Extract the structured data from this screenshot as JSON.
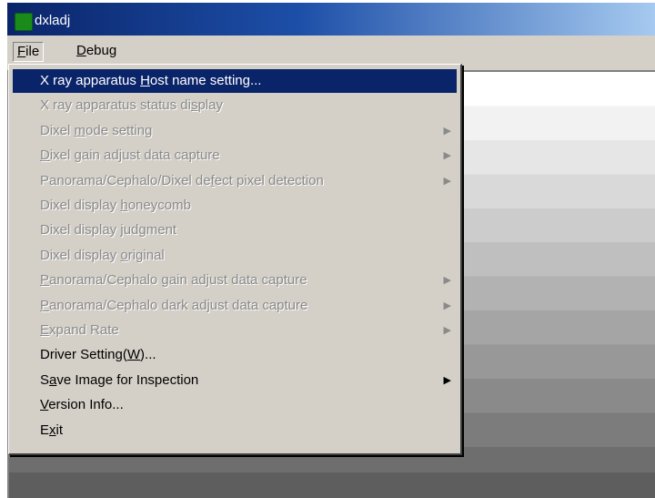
{
  "window": {
    "title": "dxladj",
    "colors": {
      "titlebar_start": "#0a246a",
      "titlebar_end": "#a6caf0",
      "selection": "#0a246a",
      "face": "#d4d0c8"
    }
  },
  "menubar": {
    "items": [
      {
        "label": "File",
        "accel": "F",
        "rest": "ile"
      },
      {
        "label": "Debug",
        "accel": "D",
        "rest": "ebug"
      }
    ]
  },
  "file_menu": {
    "items": [
      {
        "pre": "X ray apparatus ",
        "accel": "H",
        "post": "ost name setting...",
        "enabled": true,
        "selected": true,
        "submenu": false
      },
      {
        "pre": "X ray apparatus status di",
        "accel": "s",
        "post": "play",
        "enabled": false,
        "selected": false,
        "submenu": false
      },
      {
        "pre": "Dixel ",
        "accel": "m",
        "post": "ode setting",
        "enabled": false,
        "selected": false,
        "submenu": true
      },
      {
        "pre": "",
        "accel": "D",
        "post": "ixel gain adjust data capture",
        "enabled": false,
        "selected": false,
        "submenu": true
      },
      {
        "pre": "Panorama/Cephalo/Dixel de",
        "accel": "f",
        "post": "ect pixel detection",
        "enabled": false,
        "selected": false,
        "submenu": true
      },
      {
        "pre": "Dixel display ",
        "accel": "h",
        "post": "oneycomb",
        "enabled": false,
        "selected": false,
        "submenu": false
      },
      {
        "pre": "Dixel display ",
        "accel": "j",
        "post": "udgment",
        "enabled": false,
        "selected": false,
        "submenu": false
      },
      {
        "pre": "Dixel display ",
        "accel": "o",
        "post": "riginal",
        "enabled": false,
        "selected": false,
        "submenu": false
      },
      {
        "pre": "",
        "accel": "P",
        "post": "anorama/Cephalo gain adjust data capture",
        "enabled": false,
        "selected": false,
        "submenu": true
      },
      {
        "pre": "",
        "accel": "P",
        "post": "anorama/Cephalo dark adjust data capture",
        "enabled": false,
        "selected": false,
        "submenu": true
      },
      {
        "pre": "",
        "accel": "E",
        "post": "xpand Rate",
        "enabled": false,
        "selected": false,
        "submenu": true
      },
      {
        "pre": "Driver Setting(",
        "accel": "W",
        "post": ")...",
        "enabled": true,
        "selected": false,
        "submenu": false
      },
      {
        "pre": "S",
        "accel": "a",
        "post": "ve Image for Inspection",
        "enabled": true,
        "selected": false,
        "submenu": true
      },
      {
        "pre": "",
        "accel": "V",
        "post": "ersion Info...",
        "enabled": true,
        "selected": false,
        "submenu": false
      },
      {
        "pre": "E",
        "accel": "x",
        "post": "it",
        "enabled": true,
        "selected": false,
        "submenu": false
      }
    ],
    "submenu_arrow": "▶"
  }
}
